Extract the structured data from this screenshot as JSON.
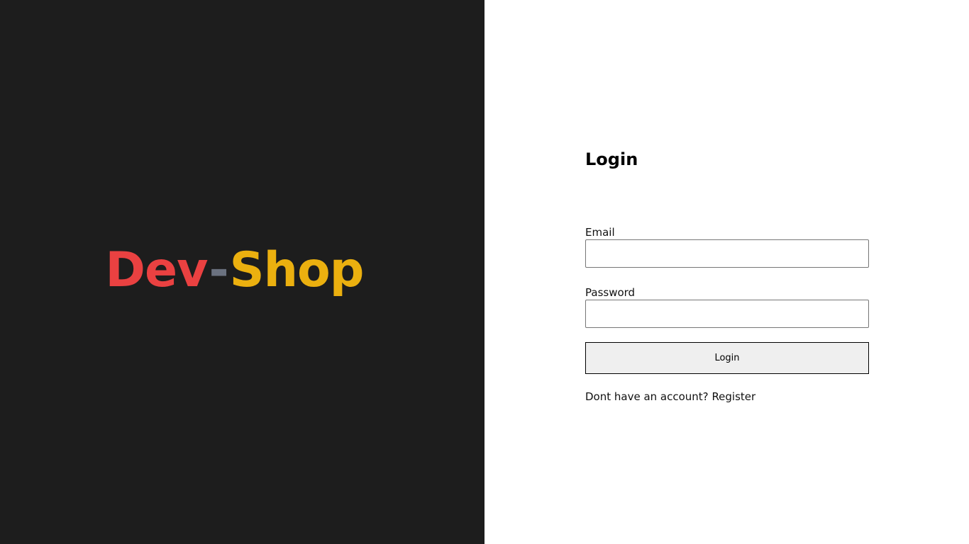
{
  "brand": {
    "part_a": "Dev",
    "separator": "-",
    "part_b": "Shop",
    "colors": {
      "part_a": "#ea4141",
      "separator": "#6b7280",
      "part_b": "#ebb00f",
      "panel_background": "#1d1d1d"
    }
  },
  "login_form": {
    "title": "Login",
    "email_label": "Email",
    "email_value": "",
    "password_label": "Password",
    "password_value": "",
    "submit_label": "Login",
    "register_prompt": "Dont have an account?",
    "register_link": "Register"
  }
}
